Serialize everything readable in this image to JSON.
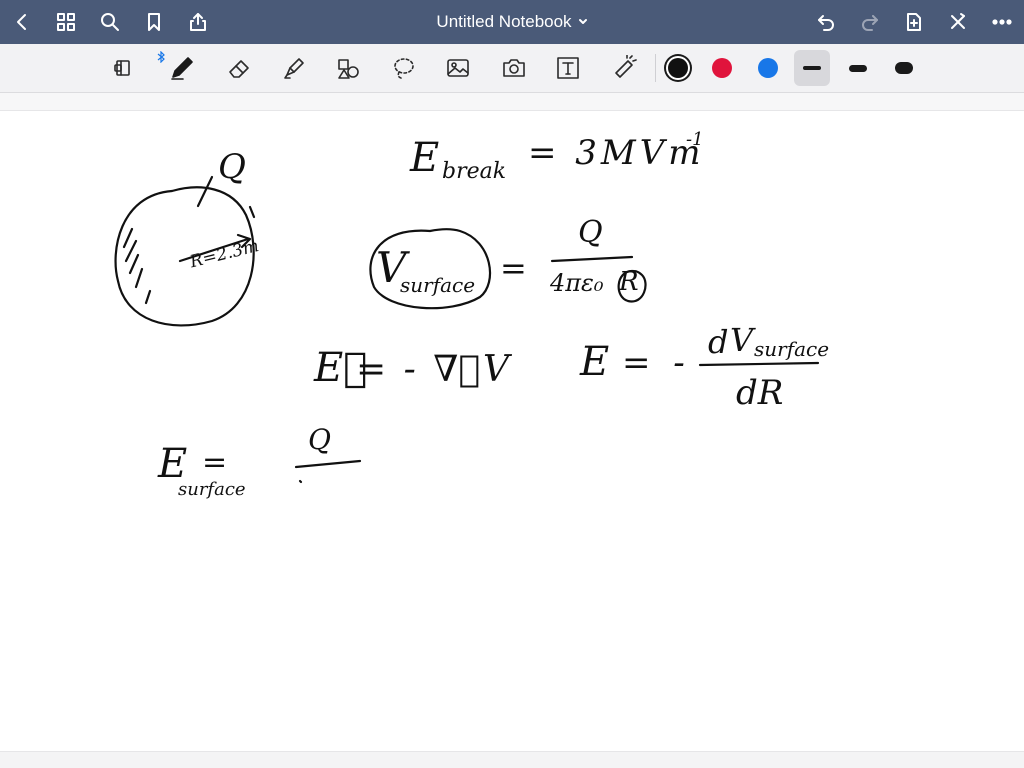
{
  "header": {
    "title": "Untitled Notebook",
    "icons": [
      "back-icon",
      "grid-icon",
      "search-icon",
      "bookmark-icon",
      "share-icon",
      "undo-icon",
      "redo-icon",
      "add-page-icon",
      "close-icon",
      "more-icon"
    ]
  },
  "toolbar": {
    "tools": [
      "lasso-read-icon",
      "pen-icon",
      "eraser-icon",
      "highlighter-icon",
      "shapes-icon",
      "lasso-icon",
      "image-icon",
      "camera-icon",
      "text-icon",
      "laser-pointer-icon"
    ],
    "colors": [
      "#111111",
      "#e0143c",
      "#1877e8"
    ],
    "selected_color": "#111111"
  },
  "notes": {
    "charge_label": "Q",
    "radius_label": "R=2.3m",
    "ebreak_E": "E",
    "ebreak_sub": "break",
    "ebreak_rhs": "= 3MVm",
    "ebreak_exp": "-1",
    "vsurface_V": "V",
    "vsurface_sub": "surface",
    "equals_1": "=",
    "frac1_num": "Q",
    "frac1_den": "4πε₀",
    "frac1_den_R": "R",
    "grad_lhs": "E⃗",
    "grad_rhs": "= - ∇⃗V",
    "e_lhs": "E",
    "e_eq": "= -",
    "frac2_num_d": "d",
    "frac2_num_V": "V",
    "frac2_num_sub": "surface",
    "frac2_den": "dR",
    "esurf_E": "E",
    "esurf_sub": "surface",
    "esurf_eq": "=",
    "frac3_num": "Q"
  }
}
